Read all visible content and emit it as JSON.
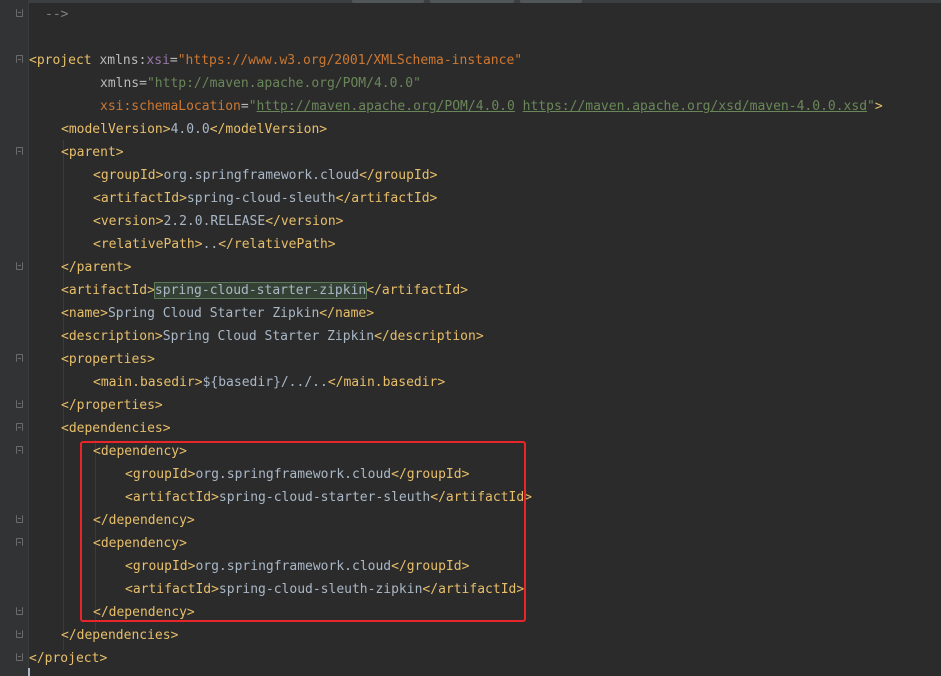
{
  "editor": {
    "lines": {
      "l0": {
        "comment": "-->"
      },
      "l2": {
        "open": "<project ",
        "ns1": "xmlns",
        "colon1": ":",
        "attr1": "xsi",
        "eq1": "=",
        "val1": "\"https://www.w3.org/2001/XMLSchema-instance\""
      },
      "l3": {
        "attr": "xmlns",
        "eq": "=",
        "val": "\"http://maven.apache.org/POM/4.0.0\""
      },
      "l4": {
        "ns": "xsi:schemaLocation",
        "eq": "=",
        "q1": "\"",
        "link1": "http://maven.apache.org/POM/4.0.0",
        "sp": " ",
        "link2": "https://maven.apache.org/xsd/maven-4.0.0.xsd",
        "q2": "\"",
        "close": ">"
      },
      "l5": {
        "open": "<modelVersion>",
        "text": "4.0.0",
        "close": "</modelVersion>"
      },
      "l6": {
        "open": "<parent>"
      },
      "l7": {
        "open": "<groupId>",
        "text": "org.springframework.cloud",
        "close": "</groupId>"
      },
      "l8": {
        "open": "<artifactId>",
        "text": "spring-cloud-sleuth",
        "close": "</artifactId>"
      },
      "l9": {
        "open": "<version>",
        "text": "2.2.0.RELEASE",
        "close": "</version>"
      },
      "l10": {
        "open": "<relativePath>",
        "text": "..",
        "close": "</relativePath>"
      },
      "l11": {
        "open": "</parent>"
      },
      "l12": {
        "open": "<artifactId>",
        "text": "spring-cloud-starter-zipkin",
        "close": "</artifactId>"
      },
      "l13": {
        "open": "<name>",
        "text": "Spring Cloud Starter Zipkin",
        "close": "</name>"
      },
      "l14": {
        "open": "<description>",
        "text": "Spring Cloud Starter Zipkin",
        "close": "</description>"
      },
      "l15": {
        "open": "<properties>"
      },
      "l16": {
        "open": "<main.basedir>",
        "text": "${basedir}/../..",
        "close": "</main.basedir>"
      },
      "l17": {
        "open": "</properties>"
      },
      "l18": {
        "open": "<dependencies>"
      },
      "l19": {
        "open": "<dependency>"
      },
      "l20": {
        "open": "<groupId>",
        "text": "org.springframework.cloud",
        "close": "</groupId>"
      },
      "l21": {
        "open": "<artifactId>",
        "text": "spring-cloud-starter-sleuth",
        "close": "</artifactId>"
      },
      "l22": {
        "open": "</dependency>"
      },
      "l23": {
        "open": "<dependency>"
      },
      "l24": {
        "open": "<groupId>",
        "text": "org.springframework.cloud",
        "close": "</groupId>"
      },
      "l25": {
        "open": "<artifactId>",
        "text": "spring-cloud-sleuth-zipkin",
        "close": "</artifactId>"
      },
      "l26": {
        "open": "</dependency>"
      },
      "l27": {
        "open": "</dependencies>"
      },
      "l28": {
        "open": "</project>"
      }
    }
  },
  "colors": {
    "background": "#2b2b2b",
    "gutter": "#313335",
    "tag": "#e8bf6a",
    "text": "#a9b7c6",
    "string": "#6a8759",
    "namespace": "#9876aa",
    "annotation_box": "#e8262a"
  }
}
